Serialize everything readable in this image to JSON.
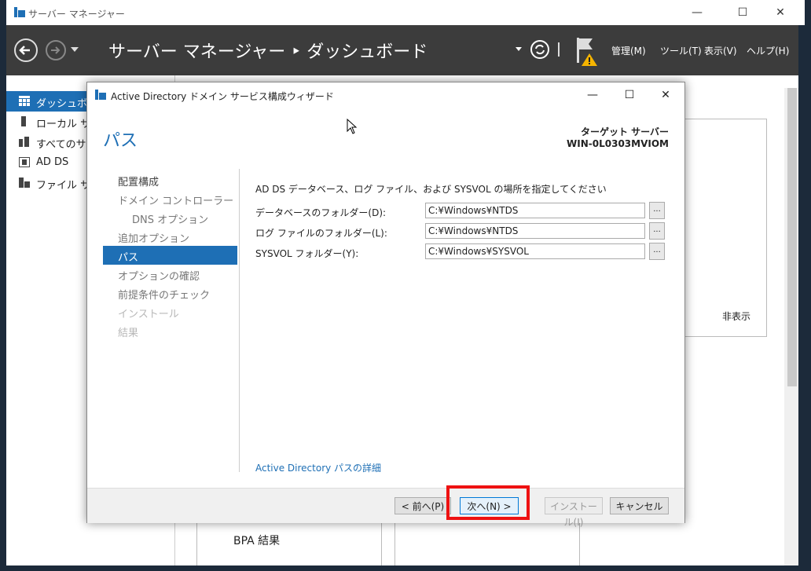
{
  "app": {
    "window_title": "サーバー マネージャー",
    "breadcrumb": "サーバー マネージャー ‣ ダッシュボード",
    "menus": [
      "管理(M)",
      "ツール(T)",
      "表示(V)",
      "ヘルプ(H)"
    ],
    "sidebar": [
      {
        "label": "ダッシュボード"
      },
      {
        "label": "ローカル サーバー"
      },
      {
        "label": "すべてのサーバー"
      },
      {
        "label": "AD DS"
      },
      {
        "label": "ファイル サービス"
      }
    ],
    "hide_label": "非表示",
    "bpa_label": "BPA 結果"
  },
  "dialog": {
    "title": "Active Directory ドメイン サービス構成ウィザード",
    "page_title": "パス",
    "target_label": "ターゲット サーバー",
    "target_server": "WIN-0L0303MVIOM",
    "steps": [
      {
        "label": "配置構成",
        "state": "done"
      },
      {
        "label": "ドメイン コントローラー オプション",
        "state": "done"
      },
      {
        "label": "DNS オプション",
        "state": "done"
      },
      {
        "label": "追加オプション",
        "state": "done"
      },
      {
        "label": "パス",
        "state": "active"
      },
      {
        "label": "オプションの確認",
        "state": "todo"
      },
      {
        "label": "前提条件のチェック",
        "state": "todo"
      },
      {
        "label": "インストール",
        "state": "disabled"
      },
      {
        "label": "結果",
        "state": "disabled"
      }
    ],
    "instruction": "AD DS データベース、ログ ファイル、および SYSVOL の場所を指定してください",
    "fields": [
      {
        "label": "データベースのフォルダー(D):",
        "value": "C:¥Windows¥NTDS"
      },
      {
        "label": "ログ ファイルのフォルダー(L):",
        "value": "C:¥Windows¥NTDS"
      },
      {
        "label": "SYSVOL フォルダー(Y):",
        "value": "C:¥Windows¥SYSVOL"
      }
    ],
    "browse_label": "...",
    "more_link": "Active Directory パスの詳細",
    "buttons": {
      "prev": "< 前へ(P)",
      "next": "次へ(N) >",
      "install": "インストール(I)",
      "cancel": "キャンセル"
    }
  },
  "colors": {
    "accent": "#1e6fb5",
    "highlight": "#e11111",
    "header_bg": "#3c3c3c"
  }
}
